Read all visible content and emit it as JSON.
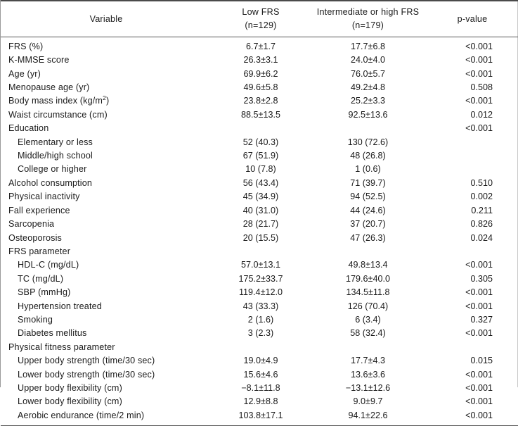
{
  "table": {
    "columns": [
      {
        "key": "variable",
        "label": "Variable",
        "sub": ""
      },
      {
        "key": "low_frs",
        "label": "Low FRS",
        "sub": "(n=129)"
      },
      {
        "key": "inter_high_frs",
        "label": "Intermediate or high FRS",
        "sub": "(n=179)"
      },
      {
        "key": "p_value",
        "label": "p-value",
        "sub": ""
      }
    ],
    "rows": [
      {
        "variable": "FRS (%)",
        "indent": 0,
        "low_frs": "6.7±1.7",
        "inter_high_frs": "17.7±6.8",
        "p_value": "<0.001"
      },
      {
        "variable": "K-MMSE score",
        "indent": 0,
        "low_frs": "26.3±3.1",
        "inter_high_frs": "24.0±4.0",
        "p_value": "<0.001"
      },
      {
        "variable": "Age (yr)",
        "indent": 0,
        "low_frs": "69.9±6.2",
        "inter_high_frs": "76.0±5.7",
        "p_value": "<0.001"
      },
      {
        "variable": "Menopause age (yr)",
        "indent": 0,
        "low_frs": "49.6±5.8",
        "inter_high_frs": "49.2±4.8",
        "p_value": "0.508"
      },
      {
        "variable": "Body mass index (kg/m",
        "variable_sup": "2",
        "variable_tail": ")",
        "indent": 0,
        "low_frs": "23.8±2.8",
        "inter_high_frs": "25.2±3.3",
        "p_value": "<0.001"
      },
      {
        "variable": "Waist circumstance (cm)",
        "indent": 0,
        "low_frs": "88.5±13.5",
        "inter_high_frs": "92.5±13.6",
        "p_value": "0.012"
      },
      {
        "variable": "Education",
        "indent": 0,
        "low_frs": "",
        "inter_high_frs": "",
        "p_value": "<0.001"
      },
      {
        "variable": "Elementary or less",
        "indent": 1,
        "low_frs": "52 (40.3)",
        "inter_high_frs": "130 (72.6)",
        "p_value": ""
      },
      {
        "variable": "Middle/high school",
        "indent": 1,
        "low_frs": "67 (51.9)",
        "inter_high_frs": "48 (26.8)",
        "p_value": ""
      },
      {
        "variable": "College or higher",
        "indent": 1,
        "low_frs": "10 (7.8)",
        "inter_high_frs": "1 (0.6)",
        "p_value": ""
      },
      {
        "variable": "Alcohol consumption",
        "indent": 0,
        "low_frs": "56 (43.4)",
        "inter_high_frs": "71 (39.7)",
        "p_value": "0.510"
      },
      {
        "variable": "Physical inactivity",
        "indent": 0,
        "low_frs": "45 (34.9)",
        "inter_high_frs": "94 (52.5)",
        "p_value": "0.002"
      },
      {
        "variable": "Fall experience",
        "indent": 0,
        "low_frs": "40 (31.0)",
        "inter_high_frs": "44 (24.6)",
        "p_value": "0.211"
      },
      {
        "variable": "Sarcopenia",
        "indent": 0,
        "low_frs": "28 (21.7)",
        "inter_high_frs": "37 (20.7)",
        "p_value": "0.826"
      },
      {
        "variable": "Osteoporosis",
        "indent": 0,
        "low_frs": "20 (15.5)",
        "inter_high_frs": "47 (26.3)",
        "p_value": "0.024"
      },
      {
        "variable": "FRS parameter",
        "indent": 0,
        "low_frs": "",
        "inter_high_frs": "",
        "p_value": ""
      },
      {
        "variable": "HDL-C (mg/dL)",
        "indent": 1,
        "low_frs": "57.0±13.1",
        "inter_high_frs": "49.8±13.4",
        "p_value": "<0.001"
      },
      {
        "variable": "TC (mg/dL)",
        "indent": 1,
        "low_frs": "175.2±33.7",
        "inter_high_frs": "179.6±40.0",
        "p_value": "0.305"
      },
      {
        "variable": "SBP (mmHg)",
        "indent": 1,
        "low_frs": "119.4±12.0",
        "inter_high_frs": "134.5±11.8",
        "p_value": "<0.001"
      },
      {
        "variable": "Hypertension treated",
        "indent": 1,
        "low_frs": "43 (33.3)",
        "inter_high_frs": "126 (70.4)",
        "p_value": "<0.001"
      },
      {
        "variable": "Smoking",
        "indent": 1,
        "low_frs": "2 (1.6)",
        "inter_high_frs": "6 (3.4)",
        "p_value": "0.327"
      },
      {
        "variable": "Diabetes mellitus",
        "indent": 1,
        "low_frs": "3 (2.3)",
        "inter_high_frs": "58 (32.4)",
        "p_value": "<0.001"
      },
      {
        "variable": "Physical fitness parameter",
        "indent": 0,
        "low_frs": "",
        "inter_high_frs": "",
        "p_value": ""
      },
      {
        "variable": "Upper body strength (time/30 sec)",
        "indent": 1,
        "low_frs": "19.0±4.9",
        "inter_high_frs": "17.7±4.3",
        "p_value": "0.015"
      },
      {
        "variable": "Lower body strength (time/30 sec)",
        "indent": 1,
        "low_frs": "15.6±4.6",
        "inter_high_frs": "13.6±3.6",
        "p_value": "<0.001"
      },
      {
        "variable": "Upper body flexibility (cm)",
        "indent": 1,
        "low_frs": "−8.1±11.8",
        "inter_high_frs": "−13.1±12.6",
        "p_value": "<0.001"
      },
      {
        "variable": "Lower body flexibility (cm)",
        "indent": 1,
        "low_frs": "12.9±8.8",
        "inter_high_frs": "9.0±9.7",
        "p_value": "<0.001"
      },
      {
        "variable": "Aerobic endurance (time/2 min)",
        "indent": 1,
        "low_frs": "103.8±17.1",
        "inter_high_frs": "94.1±22.6",
        "p_value": "<0.001"
      }
    ]
  }
}
